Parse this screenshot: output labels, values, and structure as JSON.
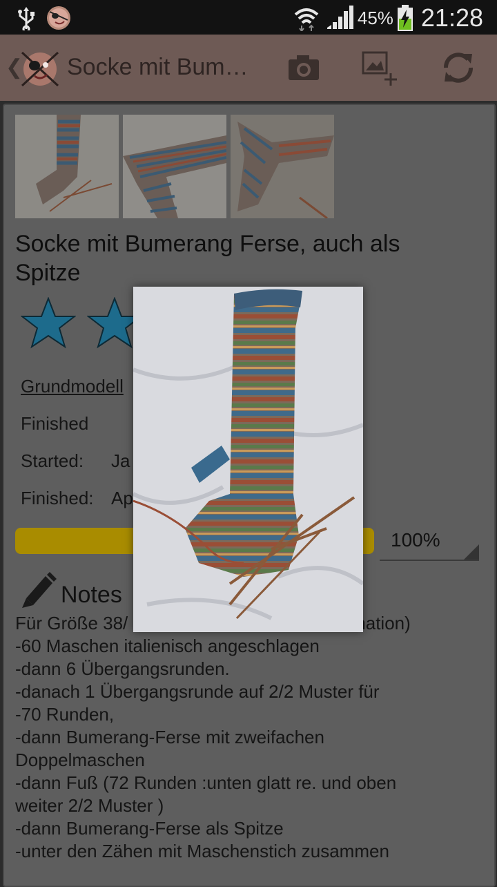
{
  "status_bar": {
    "battery_percent": "45%",
    "time": "21:28",
    "icons": [
      "usb-icon",
      "app-notification-icon",
      "wifi-icon",
      "signal-icon",
      "battery-charging-icon"
    ]
  },
  "action_bar": {
    "title": "Socke mit Bum…",
    "icons": [
      "back-icon",
      "app-logo-icon",
      "camera-icon",
      "add-image-icon",
      "refresh-icon"
    ]
  },
  "pattern": {
    "title": "Socke mit Bumerang Ferse,  auch als Spitze",
    "rating_visible_stars": 2,
    "link": "Grundmodell",
    "status": "Finished",
    "started_label": "Started:",
    "started_value_partial": "Ja",
    "finished_label": "Finished:",
    "finished_value_partial": "Ap",
    "progress_percent": 100,
    "progress_label": "100%"
  },
  "notes": {
    "heading": "Notes",
    "lines": [
      "Für Größe 38/",
      "nation)",
      "-60 Maschen italienisch angeschlagen",
      "-dann 6 Übergangsrunden.",
      "-danach 1 Übergangsrunde auf 2/2 Muster für",
      "-70 Runden,",
      "-dann Bumerang-Ferse mit zweifachen",
      "Doppelmaschen",
      "-dann Fuß (72 Runden :unten glatt re. und oben",
      "weiter 2/2 Muster )",
      "-dann Bumerang-Ferse als Spitze",
      "-unter den Zähen mit Maschenstich zusammen"
    ]
  },
  "colors": {
    "action_bar": "#6e5a55",
    "overlay_content": "#5e5e5e",
    "star": "#1d6b8c",
    "progress": "#a98c00"
  }
}
